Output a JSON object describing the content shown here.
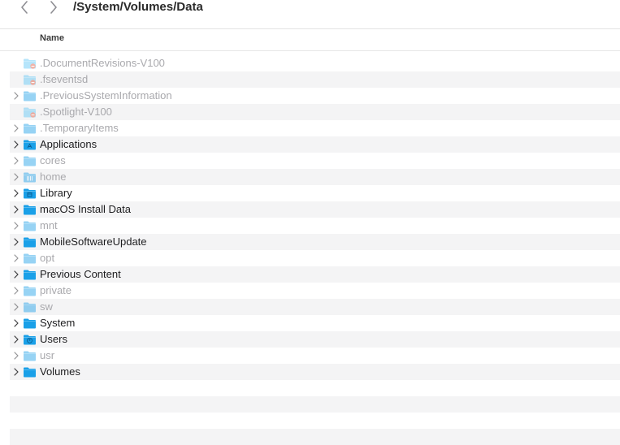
{
  "toolbar": {
    "back_icon": "chevron-left-icon",
    "forward_icon": "chevron-right-icon",
    "path_title": "/System/Volumes/Data"
  },
  "columns": {
    "name": "Name"
  },
  "colors": {
    "folder_blue": "#1aa0e8",
    "folder_light": "#5fc6f7",
    "dim_text": "#a9a9ad",
    "row_stripe": "#f4f4f5",
    "no_access_badge": "#e0593f"
  },
  "items": [
    {
      "name": ".DocumentRevisions-V100",
      "icon": "restricted-folder-icon",
      "expandable": false,
      "dim": true
    },
    {
      "name": ".fseventsd",
      "icon": "restricted-folder-icon",
      "expandable": false,
      "dim": true
    },
    {
      "name": ".PreviousSystemInformation",
      "icon": "folder-icon",
      "expandable": true,
      "dim": true
    },
    {
      "name": ".Spotlight-V100",
      "icon": "restricted-folder-icon",
      "expandable": false,
      "dim": true
    },
    {
      "name": ".TemporaryItems",
      "icon": "folder-icon",
      "expandable": true,
      "dim": true
    },
    {
      "name": "Applications",
      "icon": "applications-folder-icon",
      "expandable": true,
      "dim": false
    },
    {
      "name": "cores",
      "icon": "folder-icon",
      "expandable": true,
      "dim": true
    },
    {
      "name": "home",
      "icon": "network-folder-icon",
      "expandable": true,
      "dim": true
    },
    {
      "name": "Library",
      "icon": "library-folder-icon",
      "expandable": true,
      "dim": false
    },
    {
      "name": "macOS Install Data",
      "icon": "folder-icon",
      "expandable": true,
      "dim": false
    },
    {
      "name": "mnt",
      "icon": "folder-icon",
      "expandable": true,
      "dim": true
    },
    {
      "name": "MobileSoftwareUpdate",
      "icon": "folder-icon",
      "expandable": true,
      "dim": false
    },
    {
      "name": "opt",
      "icon": "folder-icon",
      "expandable": true,
      "dim": true
    },
    {
      "name": "Previous Content",
      "icon": "folder-icon",
      "expandable": true,
      "dim": false
    },
    {
      "name": "private",
      "icon": "folder-icon",
      "expandable": true,
      "dim": true
    },
    {
      "name": "sw",
      "icon": "folder-icon",
      "expandable": true,
      "dim": true
    },
    {
      "name": "System",
      "icon": "folder-icon",
      "expandable": true,
      "dim": false
    },
    {
      "name": "Users",
      "icon": "users-folder-icon",
      "expandable": true,
      "dim": false
    },
    {
      "name": "usr",
      "icon": "folder-icon",
      "expandable": true,
      "dim": true
    },
    {
      "name": "Volumes",
      "icon": "folder-icon",
      "expandable": true,
      "dim": false
    }
  ]
}
